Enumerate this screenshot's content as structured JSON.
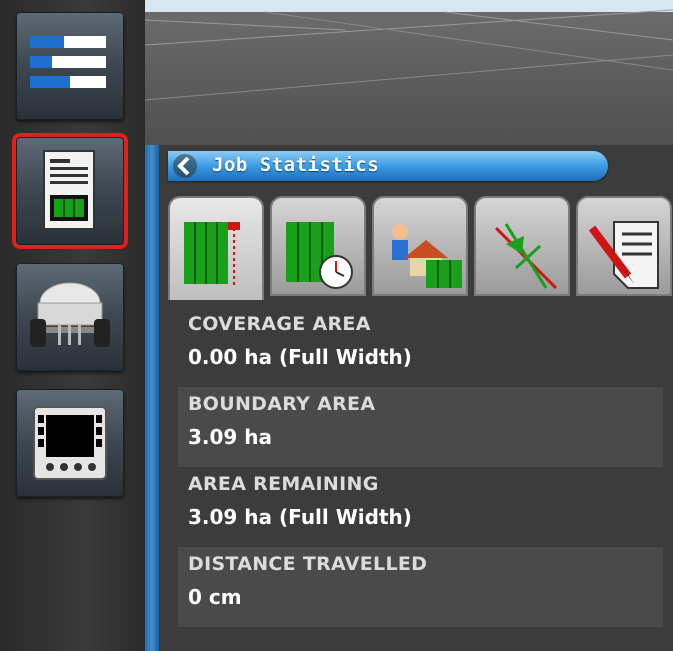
{
  "panel": {
    "title": "Job Statistics",
    "back_icon": "chevron-left-icon"
  },
  "sidebar": {
    "items": [
      {
        "icon": "status-bars-icon",
        "selected": false
      },
      {
        "icon": "job-report-icon",
        "selected": true
      },
      {
        "icon": "sprayer-vehicle-icon",
        "selected": false
      },
      {
        "icon": "film-display-icon",
        "selected": false
      }
    ]
  },
  "tabs": [
    {
      "icon": "coverage-field-icon",
      "active": true
    },
    {
      "icon": "field-time-icon",
      "active": false
    },
    {
      "icon": "client-farm-field-icon",
      "active": false
    },
    {
      "icon": "guideline-icon",
      "active": false
    },
    {
      "icon": "notes-pencil-icon",
      "active": false
    }
  ],
  "stats": [
    {
      "label": "COVERAGE AREA",
      "value": "0.00 ha (Full Width)"
    },
    {
      "label": "BOUNDARY AREA",
      "value": "3.09 ha"
    },
    {
      "label": "AREA REMAINING",
      "value": "3.09 ha (Full Width)"
    },
    {
      "label": "DISTANCE TRAVELLED",
      "value": "0 cm"
    }
  ],
  "colors": {
    "accent_blue": "#3a9be3",
    "selected_outline": "#e0201a",
    "field_green": "#18a01a"
  }
}
